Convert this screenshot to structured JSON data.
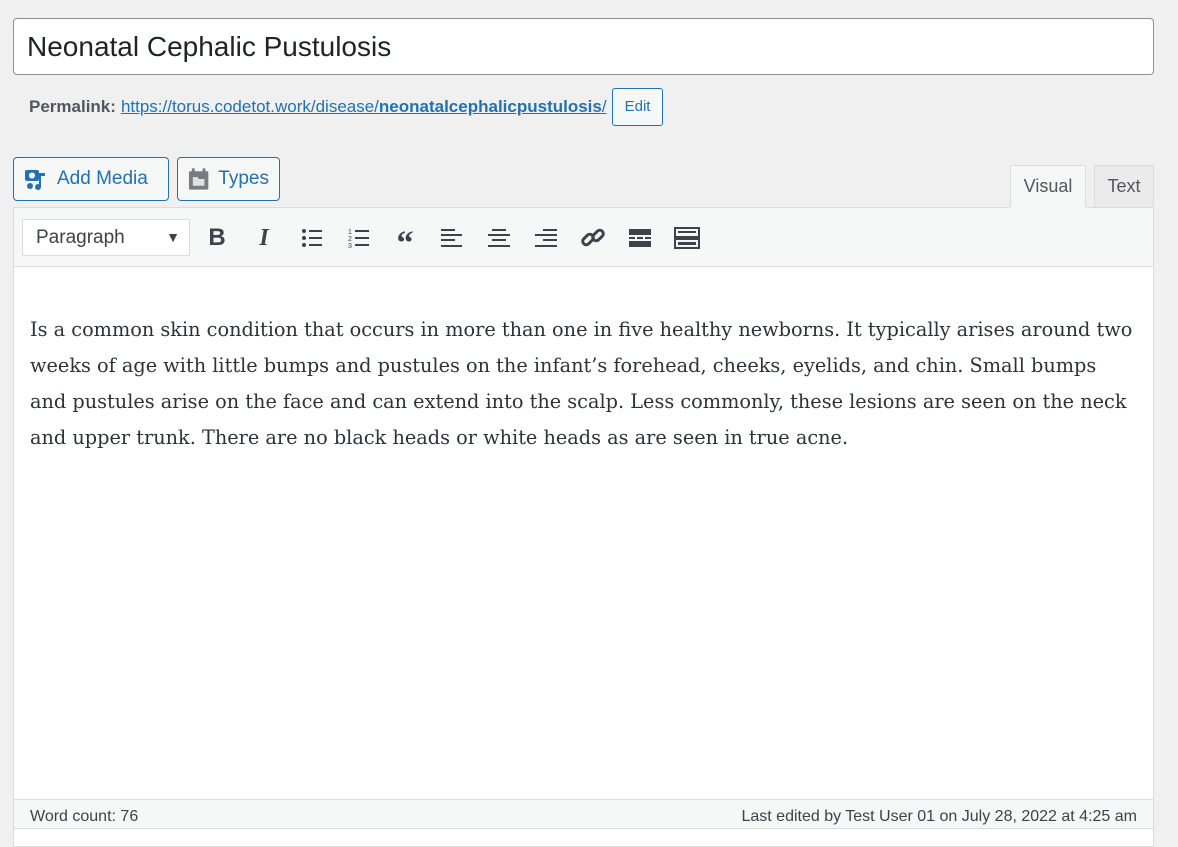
{
  "title": "Neonatal Cephalic Pustulosis",
  "permalink": {
    "label": "Permalink:",
    "url_base": "https://torus.codetot.work/disease/",
    "slug": "neonatalcephalicpustulosis",
    "trail": "/",
    "edit": "Edit"
  },
  "buttons": {
    "add_media": "Add Media",
    "types": "Types"
  },
  "tabs": {
    "visual": "Visual",
    "text": "Text"
  },
  "toolbar": {
    "format": "Paragraph"
  },
  "content": "Is a common skin condition that occurs in more than one in five healthy newborns. It typically arises around two weeks of age with little bumps and pustules on the infant’s forehead, cheeks, eyelids, and chin. Small bumps and pustules arise on the face and can extend into the scalp. Less commonly, these lesions are seen on the neck and upper trunk. There are no black heads or white heads as are seen in true acne.",
  "status": {
    "word_count": "Word count: 76",
    "last_edited": "Last edited by Test User 01 on July 28, 2022 at 4:25 am"
  }
}
